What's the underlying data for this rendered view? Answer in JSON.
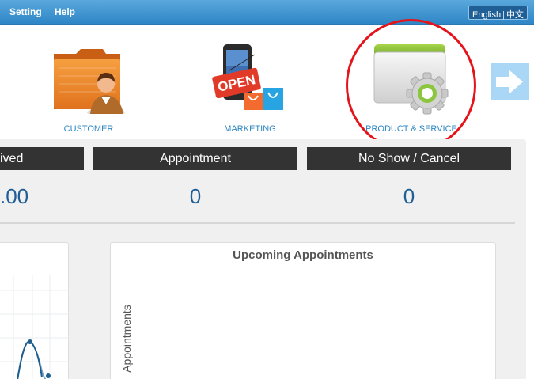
{
  "topbar": {
    "menu": [
      "Setting",
      "Help"
    ],
    "language": {
      "english": "English",
      "chinese": "中文"
    }
  },
  "tiles": [
    {
      "label": "CUSTOMER",
      "icon": "customer-folder-icon"
    },
    {
      "label": "MARKETING",
      "icon": "marketing-open-sign-icon"
    },
    {
      "label": "PRODUCT & SERVICE",
      "icon": "product-service-gear-icon"
    }
  ],
  "next_icon": "arrow-right-icon",
  "stats": [
    {
      "label": "ived",
      "value": ".00"
    },
    {
      "label": "Appointment",
      "value": "0"
    },
    {
      "label": "No Show / Cancel",
      "value": "0"
    }
  ],
  "upcoming": {
    "title": "Upcoming Appointments",
    "ylabel": "Appointments"
  },
  "colors": {
    "topbar": "#3a8fd0",
    "label_blue": "#2e86c1",
    "value_blue": "#1f5f96",
    "header_dark": "#333333",
    "highlight": "#e5141b"
  }
}
